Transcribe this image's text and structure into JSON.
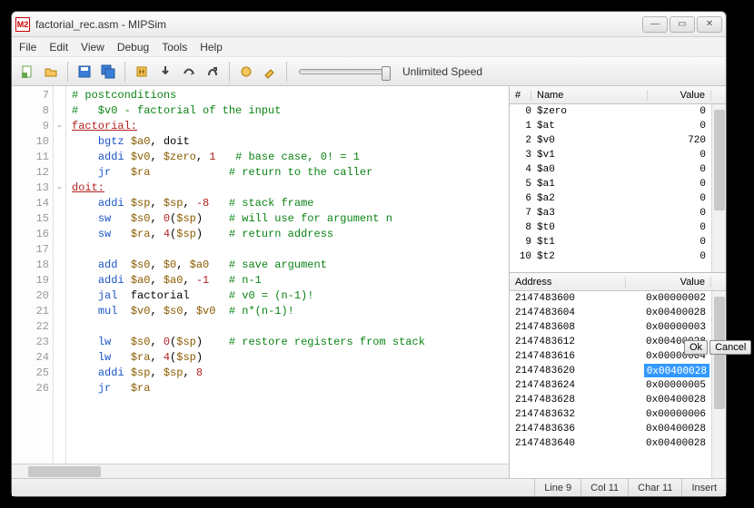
{
  "window": {
    "title": "factorial_rec.asm - MIPSim",
    "minimize_glyph": "—",
    "maximize_glyph": "▭",
    "close_glyph": "✕",
    "appicon": "M2"
  },
  "menu": {
    "items": [
      "File",
      "Edit",
      "View",
      "Debug",
      "Tools",
      "Help"
    ]
  },
  "toolbar": {
    "speed_label": "Unlimited Speed"
  },
  "editor": {
    "first_line": 7,
    "lines": [
      {
        "fold": "",
        "html": "<span class='cm'># postconditions</span>"
      },
      {
        "fold": "",
        "html": "<span class='cm'>#   $v0 - factorial of the input</span>"
      },
      {
        "fold": "-",
        "html": "<span class='lb'>factorial:</span>"
      },
      {
        "fold": "",
        "html": "    <span class='kw'>bgtz</span> <span class='rg'>$a0</span>, doit"
      },
      {
        "fold": "",
        "html": "    <span class='kw'>addi</span> <span class='rg'>$v0</span>, <span class='rg'>$zero</span>, <span class='nm'>1</span>   <span class='cm'># base case, 0! = 1</span>"
      },
      {
        "fold": "",
        "html": "    <span class='kw'>jr</span>   <span class='rg'>$ra</span>            <span class='cm'># return to the caller</span>"
      },
      {
        "fold": "-",
        "html": "<span class='lb'>doit:</span>"
      },
      {
        "fold": "",
        "html": "    <span class='kw'>addi</span> <span class='rg'>$sp</span>, <span class='rg'>$sp</span>, <span class='nm'>-8</span>   <span class='cm'># stack frame</span>"
      },
      {
        "fold": "",
        "html": "    <span class='kw'>sw</span>   <span class='rg'>$s0</span>, <span class='nm'>0</span>(<span class='rg'>$sp</span>)    <span class='cm'># will use for argument n</span>"
      },
      {
        "fold": "",
        "html": "    <span class='kw'>sw</span>   <span class='rg'>$ra</span>, <span class='nm'>4</span>(<span class='rg'>$sp</span>)    <span class='cm'># return address</span>"
      },
      {
        "fold": "",
        "html": ""
      },
      {
        "fold": "",
        "html": "    <span class='kw'>add</span>  <span class='rg'>$s0</span>, <span class='rg'>$0</span>, <span class='rg'>$a0</span>   <span class='cm'># save argument</span>"
      },
      {
        "fold": "",
        "html": "    <span class='kw'>addi</span> <span class='rg'>$a0</span>, <span class='rg'>$a0</span>, <span class='nm'>-1</span>   <span class='cm'># n-1</span>"
      },
      {
        "fold": "",
        "html": "    <span class='kw'>jal</span>  factorial      <span class='cm'># v0 = (n-1)!</span>"
      },
      {
        "fold": "",
        "html": "    <span class='kw'>mul</span>  <span class='rg'>$v0</span>, <span class='rg'>$s0</span>, <span class='rg'>$v0</span>  <span class='cm'># n*(n-1)!</span>"
      },
      {
        "fold": "",
        "html": ""
      },
      {
        "fold": "",
        "html": "    <span class='kw'>lw</span>   <span class='rg'>$s0</span>, <span class='nm'>0</span>(<span class='rg'>$sp</span>)    <span class='cm'># restore registers from stack</span>"
      },
      {
        "fold": "",
        "html": "    <span class='kw'>lw</span>   <span class='rg'>$ra</span>, <span class='nm'>4</span>(<span class='rg'>$sp</span>)"
      },
      {
        "fold": "",
        "html": "    <span class='kw'>addi</span> <span class='rg'>$sp</span>, <span class='rg'>$sp</span>, <span class='nm'>8</span>"
      },
      {
        "fold": "",
        "html": "    <span class='kw'>jr</span>   <span class='rg'>$ra</span>"
      }
    ]
  },
  "registers": {
    "headers": {
      "idx": "#",
      "name": "Name",
      "value": "Value"
    },
    "rows": [
      {
        "i": "0",
        "n": "$zero",
        "v": "0"
      },
      {
        "i": "1",
        "n": "$at",
        "v": "0"
      },
      {
        "i": "2",
        "n": "$v0",
        "v": "720"
      },
      {
        "i": "3",
        "n": "$v1",
        "v": "0"
      },
      {
        "i": "4",
        "n": "$a0",
        "v": "0"
      },
      {
        "i": "5",
        "n": "$a1",
        "v": "0"
      },
      {
        "i": "6",
        "n": "$a2",
        "v": "0"
      },
      {
        "i": "7",
        "n": "$a3",
        "v": "0"
      },
      {
        "i": "8",
        "n": "$t0",
        "v": "0"
      },
      {
        "i": "9",
        "n": "$t1",
        "v": "0"
      },
      {
        "i": "10",
        "n": "$t2",
        "v": "0"
      }
    ]
  },
  "memory": {
    "headers": {
      "addr": "Address",
      "value": "Value"
    },
    "rows": [
      {
        "a": "2147483600",
        "v": "0x00000002",
        "edit": false
      },
      {
        "a": "2147483604",
        "v": "0x00400028",
        "edit": false
      },
      {
        "a": "2147483608",
        "v": "0x00000003",
        "edit": false
      },
      {
        "a": "2147483612",
        "v": "0x00400028",
        "edit": false
      },
      {
        "a": "2147483616",
        "v": "0x00000004",
        "edit": false
      },
      {
        "a": "2147483620",
        "v": "0x00400028",
        "edit": true
      },
      {
        "a": "2147483624",
        "v": "0x00000005",
        "edit": false
      },
      {
        "a": "2147483628",
        "v": "0x00400028",
        "edit": false
      },
      {
        "a": "2147483632",
        "v": "0x00000006",
        "edit": false
      },
      {
        "a": "2147483636",
        "v": "0x00400028",
        "edit": false
      },
      {
        "a": "2147483640",
        "v": "0x00400028",
        "edit": false
      }
    ],
    "edit_buttons": {
      "ok": "Ok",
      "cancel": "Cancel"
    }
  },
  "status": {
    "line": "Line 9",
    "col": "Col 11",
    "char": "Char 11",
    "mode": "Insert"
  }
}
